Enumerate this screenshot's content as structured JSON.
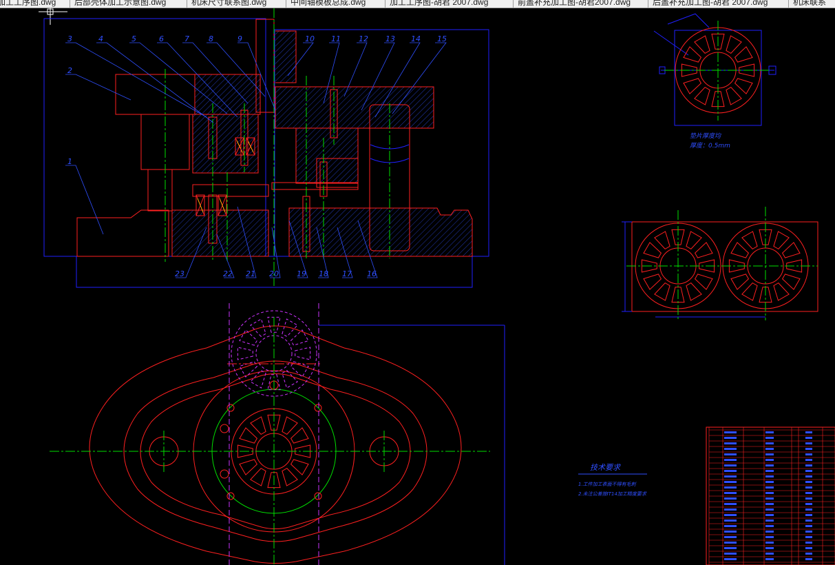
{
  "tabs": [
    {
      "label": "加工工序图.dwg"
    },
    {
      "label": "后部壳体加工示意图.dwg"
    },
    {
      "label": "机床尺寸联系图.dwg"
    },
    {
      "label": "中间轴模板总成.dwg"
    },
    {
      "label": "加工工序图-胡君 2007.dwg"
    },
    {
      "label": "前盖补充加工图-胡君2007.dwg"
    },
    {
      "label": "后盖补充加工图-胡君 2007.dwg"
    },
    {
      "label": "机床联系"
    }
  ],
  "drawing": {
    "part_numbers_top": [
      "3",
      "4",
      "5",
      "6",
      "7",
      "8",
      "9",
      "10",
      "11",
      "12",
      "13",
      "14",
      "15"
    ],
    "part_numbers_left": [
      "2",
      "1"
    ],
    "part_numbers_bottom": [
      "23",
      "22",
      "21",
      "20",
      "19",
      "18",
      "17",
      "16"
    ],
    "side_note_line1": "垫片厚度均",
    "side_note_line2": "厚度：0.5mm",
    "tech_req_title": "技术要求",
    "tech_req_line1": "1.工件加工表面不得有毛刺",
    "tech_req_line2": "2.未注公差按IT14加工精度要求"
  },
  "colors": {
    "background": "#000000",
    "outline": "#ff2020",
    "frame": "#2020ff",
    "centerline": "#00e000",
    "dashed": "#cc33ff",
    "hatch": "#3050ff",
    "text": "#2f4fff"
  }
}
